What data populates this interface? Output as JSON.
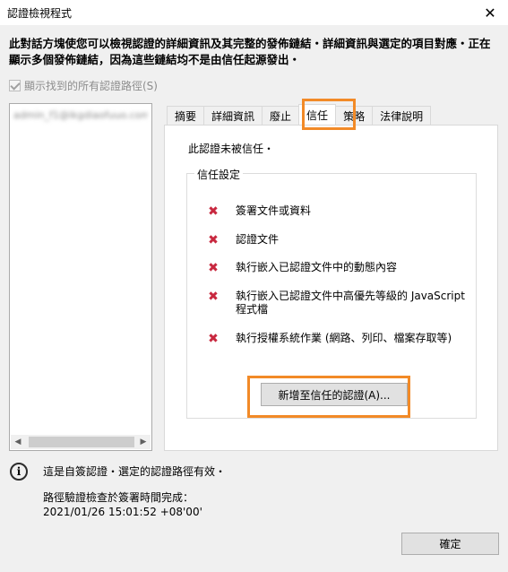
{
  "window": {
    "title": "認證檢視程式",
    "close_glyph": "✕"
  },
  "description": "此對話方塊使您可以檢視認證的詳細資訊及其完整的發佈鏈結・詳細資訊與選定的項目對應・正在顯示多個發佈鏈結，因為這些鏈結均不是由信任起源發出・",
  "show_all_paths": {
    "label": "顯示找到的所有認證路徑(S)",
    "checked": true,
    "enabled": false
  },
  "tree": {
    "items": [
      "admin_f1@ikgdiaofuuo.com"
    ]
  },
  "tabs": [
    {
      "label": "摘要",
      "active": false
    },
    {
      "label": "詳細資訊",
      "active": false
    },
    {
      "label": "廢止",
      "active": false
    },
    {
      "label": "信任",
      "active": true
    },
    {
      "label": "策略",
      "active": false
    },
    {
      "label": "法律說明",
      "active": false
    }
  ],
  "trust_panel": {
    "status_text": "此認證未被信任・",
    "group_label": "信任設定",
    "items": [
      {
        "text": "簽署文件或資料",
        "icon": "red-x-icon"
      },
      {
        "text": "認證文件",
        "icon": "red-x-icon"
      },
      {
        "text": "執行嵌入已認證文件中的動態內容",
        "icon": "red-x-icon"
      },
      {
        "text": "執行嵌入已認證文件中高優先等級的 JavaScript 程式檔",
        "icon": "red-x-icon"
      },
      {
        "text": "執行授權系統作業 (網路、列印、檔案存取等)",
        "icon": "red-x-icon"
      }
    ],
    "add_button_label": "新增至信任的認證(A)..."
  },
  "footer": {
    "info_glyph": "i",
    "self_signed_text": "這是自簽認證・選定的認證路徑有效・",
    "path_check_line1": "路徑驗證檢查於簽署時間完成：",
    "path_check_line2": "2021/01/26 15:01:52 +08'00'",
    "ok_label": "確定"
  },
  "colors": {
    "highlight": "#f28a27",
    "x_icon": "#c8283f",
    "dialog_bg": "#f0f0f0"
  }
}
